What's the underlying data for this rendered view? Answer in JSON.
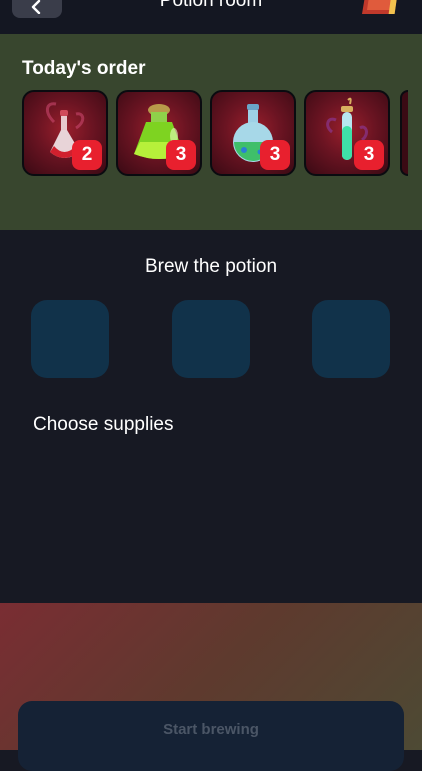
{
  "header": {
    "title": "Potion room",
    "back_icon": "chevron-left-icon",
    "book_icon": "book-icon"
  },
  "order": {
    "heading": "Today's order",
    "items": [
      {
        "icon": "red-potion-icon",
        "quantity": "2"
      },
      {
        "icon": "green-flask-icon",
        "quantity": "3"
      },
      {
        "icon": "round-blue-green-potion-icon",
        "quantity": "3"
      },
      {
        "icon": "test-tube-potion-icon",
        "quantity": "3"
      }
    ]
  },
  "brew": {
    "heading": "Brew the potion",
    "slot_count": 3
  },
  "supplies": {
    "heading": "Choose supplies"
  },
  "actions": {
    "start_label": "Start brewing"
  },
  "colors": {
    "background": "#171923",
    "order_panel": "#38462e",
    "slot": "#11324a",
    "badge": "#e8202e",
    "start_button": "#152235"
  }
}
